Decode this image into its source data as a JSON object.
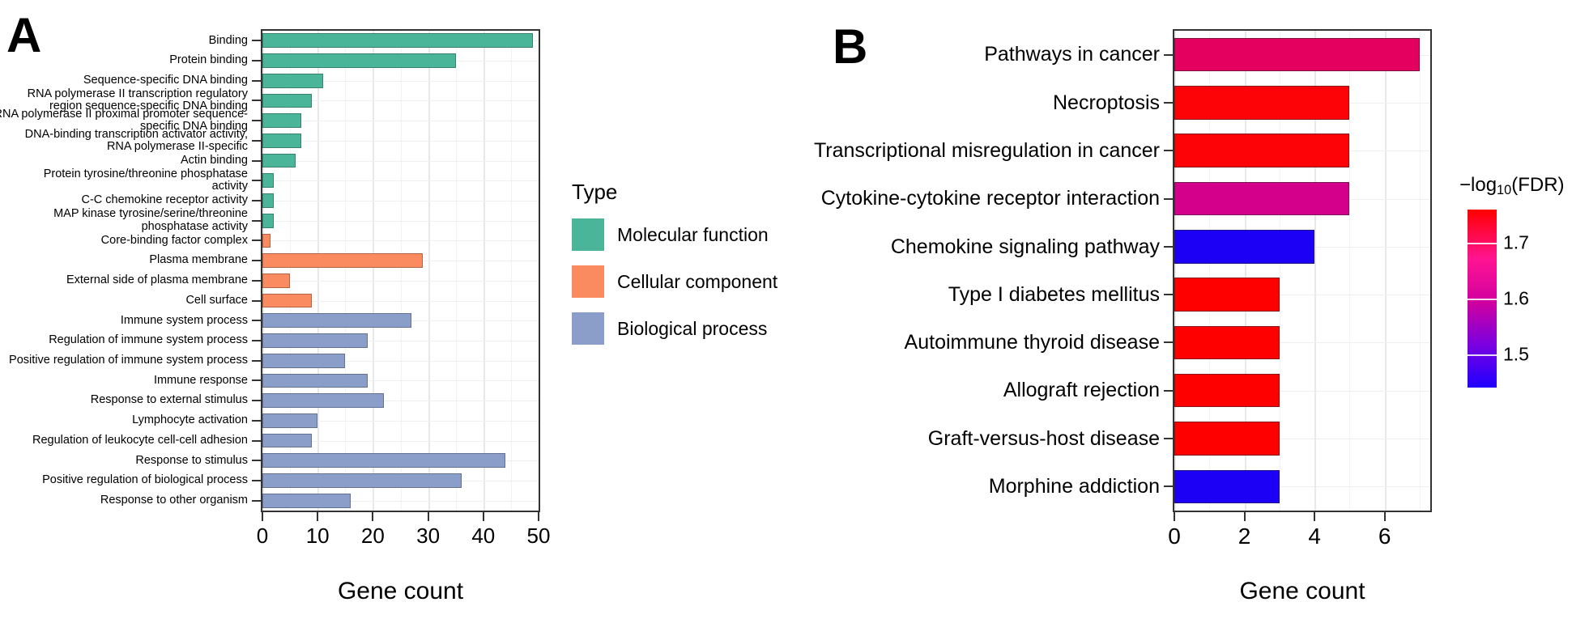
{
  "panels": {
    "a": {
      "letter": "A",
      "legend_title": "Type",
      "legend_items": [
        {
          "label": "Molecular function",
          "color": "#4bb59a"
        },
        {
          "label": "Cellular component",
          "color": "#fa8a5f"
        },
        {
          "label": "Biological process",
          "color": "#8b9dc9"
        }
      ],
      "xlabel": "Gene count",
      "xticks": [
        "0",
        "10",
        "20",
        "30",
        "40",
        "50"
      ]
    },
    "b": {
      "letter": "B",
      "xlabel": "Gene count",
      "xticks": [
        "0",
        "2",
        "4",
        "6"
      ],
      "colorbar": {
        "title_prefix": "−log",
        "title_sub": "10",
        "title_suffix": "(FDR)",
        "ticks": [
          "1.7",
          "1.6",
          "1.5"
        ],
        "tick_values": [
          1.7,
          1.6,
          1.5
        ],
        "top_color": "#ff0000",
        "bottom_color": "#2000ff",
        "range": [
          1.44,
          1.76
        ]
      }
    }
  },
  "chart_data": [
    {
      "type": "bar",
      "orientation": "horizontal",
      "panel": "A",
      "title": "",
      "xlabel": "Gene count",
      "ylabel": "",
      "xlim": [
        0,
        50
      ],
      "xticks": [
        0,
        10,
        20,
        30,
        40,
        50
      ],
      "grid": true,
      "legend": {
        "title": "Type",
        "position": "right"
      },
      "categories": [
        "Binding",
        "Protein binding",
        "Sequence-specific DNA binding",
        "RNA polymerase II transcription regulatory region sequence-specific DNA binding",
        "RNA polymerase II proximal promoter sequence-specific DNA binding",
        "DNA-binding transcription activator activity, RNA polymerase II-specific",
        "Actin binding",
        "Protein tyrosine/threonine phosphatase activity",
        "C-C chemokine receptor activity",
        "MAP kinase tyrosine/serine/threonine phosphatase activity",
        "Core-binding factor complex",
        "Plasma membrane",
        "External side of plasma membrane",
        "Cell surface",
        "Immune system process",
        "Regulation of immune system process",
        "Positive regulation of immune system process",
        "Immune response",
        "Response to external stimulus",
        "Lymphocyte activation",
        "Regulation of leukocyte cell-cell adhesion",
        "Response to stimulus",
        "Positive regulation of biological process",
        "Response to other organism"
      ],
      "category_lines": [
        [
          "Binding"
        ],
        [
          "Protein binding"
        ],
        [
          "Sequence-specific DNA binding"
        ],
        [
          "RNA polymerase II transcription regulatory",
          "region sequence-specific DNA binding"
        ],
        [
          "RNA polymerase II proximal promoter sequence-",
          "specific DNA binding"
        ],
        [
          "DNA-binding transcription activator activity,",
          "RNA polymerase II-specific"
        ],
        [
          "Actin binding"
        ],
        [
          "Protein tyrosine/threonine phosphatase",
          "activity"
        ],
        [
          "C-C chemokine receptor activity"
        ],
        [
          "MAP kinase tyrosine/serine/threonine",
          "phosphatase activity"
        ],
        [
          "Core-binding factor complex"
        ],
        [
          "Plasma membrane"
        ],
        [
          "External side of plasma membrane"
        ],
        [
          "Cell surface"
        ],
        [
          "Immune system process"
        ],
        [
          "Regulation of immune system process"
        ],
        [
          "Positive regulation of immune system process"
        ],
        [
          "Immune response"
        ],
        [
          "Response to external stimulus"
        ],
        [
          "Lymphocyte activation"
        ],
        [
          "Regulation of leukocyte cell-cell adhesion"
        ],
        [
          "Response to stimulus"
        ],
        [
          "Positive regulation of biological process"
        ],
        [
          "Response to other organism"
        ]
      ],
      "values": [
        49,
        35,
        11,
        9,
        7,
        7,
        6,
        2,
        2,
        2,
        1.5,
        29,
        5,
        9,
        27,
        19,
        15,
        19,
        22,
        10,
        9,
        44,
        36,
        16
      ],
      "groups": [
        "Molecular function",
        "Molecular function",
        "Molecular function",
        "Molecular function",
        "Molecular function",
        "Molecular function",
        "Molecular function",
        "Molecular function",
        "Molecular function",
        "Molecular function",
        "Cellular component",
        "Cellular component",
        "Cellular component",
        "Cellular component",
        "Biological process",
        "Biological process",
        "Biological process",
        "Biological process",
        "Biological process",
        "Biological process",
        "Biological process",
        "Biological process",
        "Biological process",
        "Biological process"
      ],
      "group_colors": {
        "Molecular function": "#4bb59a",
        "Cellular component": "#fa8a5f",
        "Biological process": "#8b9dc9"
      }
    },
    {
      "type": "bar",
      "orientation": "horizontal",
      "panel": "B",
      "title": "",
      "xlabel": "Gene count",
      "ylabel": "",
      "xlim": [
        0,
        7.3
      ],
      "xticks": [
        0,
        2,
        4,
        6
      ],
      "grid": true,
      "legend": {
        "title": "-log10(FDR)",
        "position": "right",
        "type": "colorbar"
      },
      "categories": [
        "Pathways in cancer",
        "Necroptosis",
        "Transcriptional misregulation in cancer",
        "Cytokine-cytokine receptor interaction",
        "Chemokine signaling pathway",
        "Type I diabetes mellitus",
        "Autoimmune thyroid disease",
        "Allograft rejection",
        "Graft-versus-host disease",
        "Morphine addiction"
      ],
      "values": [
        7,
        5,
        5,
        5,
        4,
        3,
        3,
        3,
        3,
        3
      ],
      "color_values": [
        1.63,
        1.72,
        1.72,
        1.6,
        1.44,
        1.73,
        1.73,
        1.73,
        1.73,
        1.44
      ],
      "colors": [
        "#e3005e",
        "#fd0308",
        "#fd0308",
        "#d4008c",
        "#1b00f5",
        "#ff0000",
        "#ff0000",
        "#ff0000",
        "#ff0000",
        "#1b00f5"
      ]
    }
  ]
}
